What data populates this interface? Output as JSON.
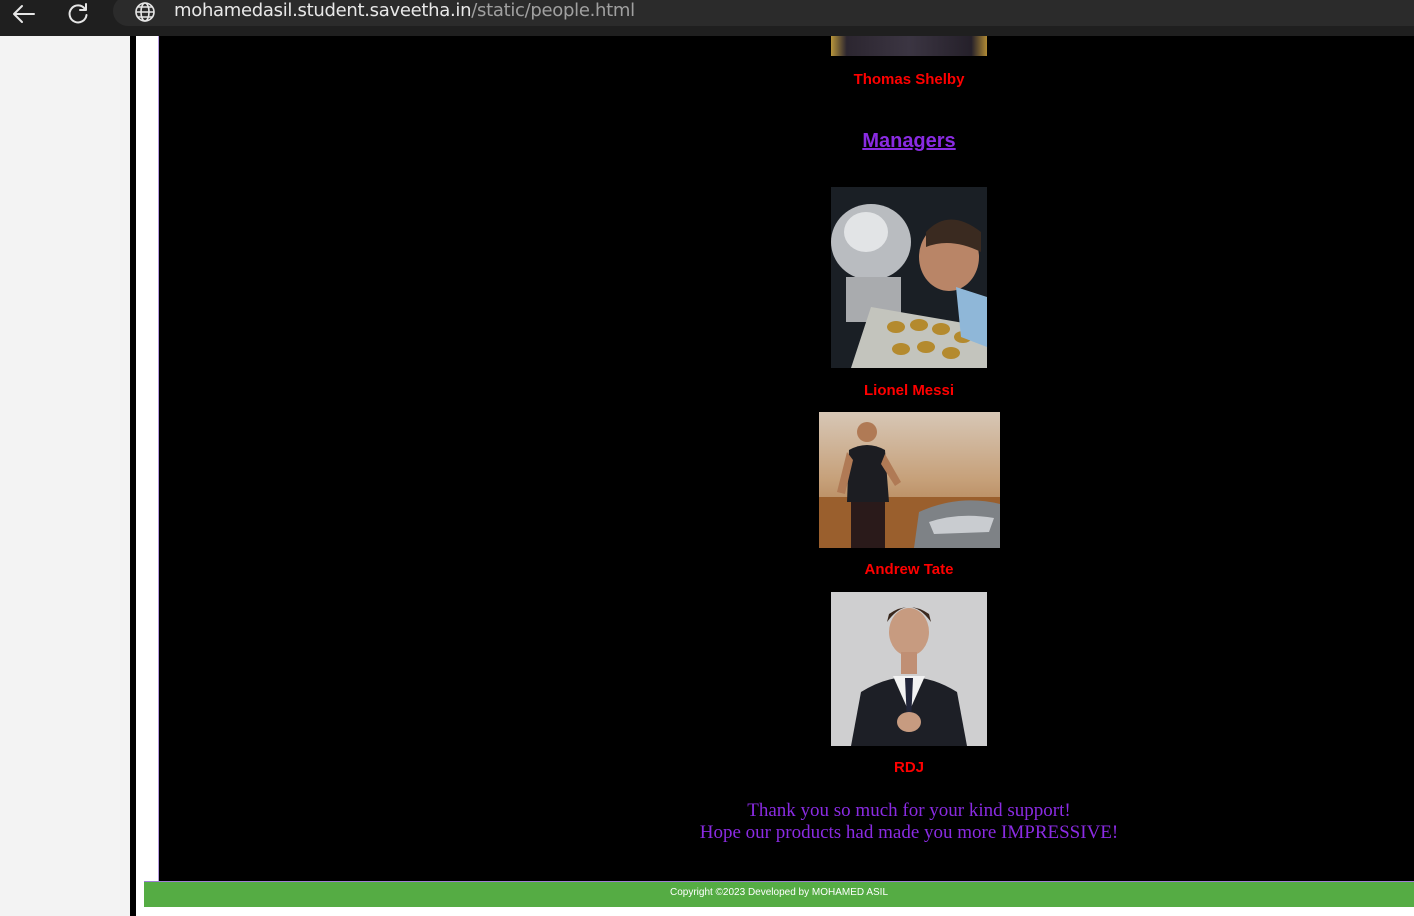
{
  "browser": {
    "url_host": "mohamedasil.student.saveetha.in",
    "url_path": "/static/people.html"
  },
  "page": {
    "prev_person": {
      "name": "Thomas Shelby"
    },
    "section_heading": "Managers",
    "managers": [
      {
        "name": "Lionel Messi"
      },
      {
        "name": "Andrew Tate"
      },
      {
        "name": "RDJ"
      }
    ],
    "thanks_line1": "Thank you so much for your kind support!",
    "thanks_line2": "Hope our products had made you more IMPRESSIVE!"
  },
  "footer": {
    "text": "Copyright ©2023 Developed by MOHAMED ASIL"
  },
  "colors": {
    "content_bg": "#000000",
    "caption": "#ff0000",
    "heading": "#8a2be2",
    "footer_bg": "#55ac44"
  }
}
